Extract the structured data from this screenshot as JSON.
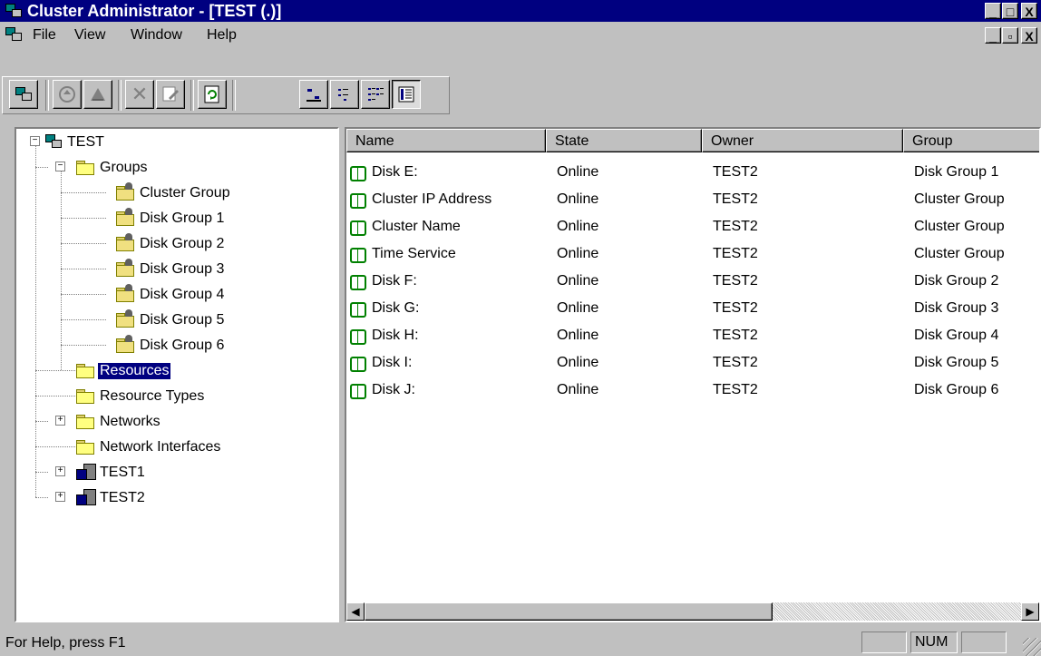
{
  "window": {
    "title": "Cluster Administrator - [TEST (.)]",
    "minimize": "_",
    "maximize": "□",
    "close": "X",
    "doc_restore": "▫"
  },
  "menu": {
    "items": [
      "File",
      "View",
      "Window",
      "Help"
    ]
  },
  "toolbar": {
    "refresh_glyph": "↻",
    "delete_glyph": "✕"
  },
  "tree": {
    "root": "TEST",
    "groups_label": "Groups",
    "groups": [
      "Cluster Group",
      "Disk Group 1",
      "Disk Group 2",
      "Disk Group 3",
      "Disk Group 4",
      "Disk Group 5",
      "Disk Group 6"
    ],
    "resources": "Resources",
    "resource_types": "Resource Types",
    "networks": "Networks",
    "network_interfaces": "Network Interfaces",
    "node1": "TEST1",
    "node2": "TEST2"
  },
  "list": {
    "columns": [
      "Name",
      "State",
      "Owner",
      "Group"
    ],
    "rows": [
      [
        "Disk E:",
        "Online",
        "TEST2",
        "Disk Group 1"
      ],
      [
        "Cluster IP Address",
        "Online",
        "TEST2",
        "Cluster Group"
      ],
      [
        "Cluster Name",
        "Online",
        "TEST2",
        "Cluster Group"
      ],
      [
        "Time Service",
        "Online",
        "TEST2",
        "Cluster Group"
      ],
      [
        "Disk F:",
        "Online",
        "TEST2",
        "Disk Group 2"
      ],
      [
        "Disk G:",
        "Online",
        "TEST2",
        "Disk Group 3"
      ],
      [
        "Disk H:",
        "Online",
        "TEST2",
        "Disk Group 4"
      ],
      [
        "Disk I:",
        "Online",
        "TEST2",
        "Disk Group 5"
      ],
      [
        "Disk J:",
        "Online",
        "TEST2",
        "Disk Group 6"
      ]
    ]
  },
  "status": {
    "help_text": "For Help, press F1",
    "num": "NUM"
  },
  "colors": {
    "titlebar": "#000080",
    "face": "#c0c0c0",
    "selection": "#000080",
    "resource_icon": "#008000"
  }
}
